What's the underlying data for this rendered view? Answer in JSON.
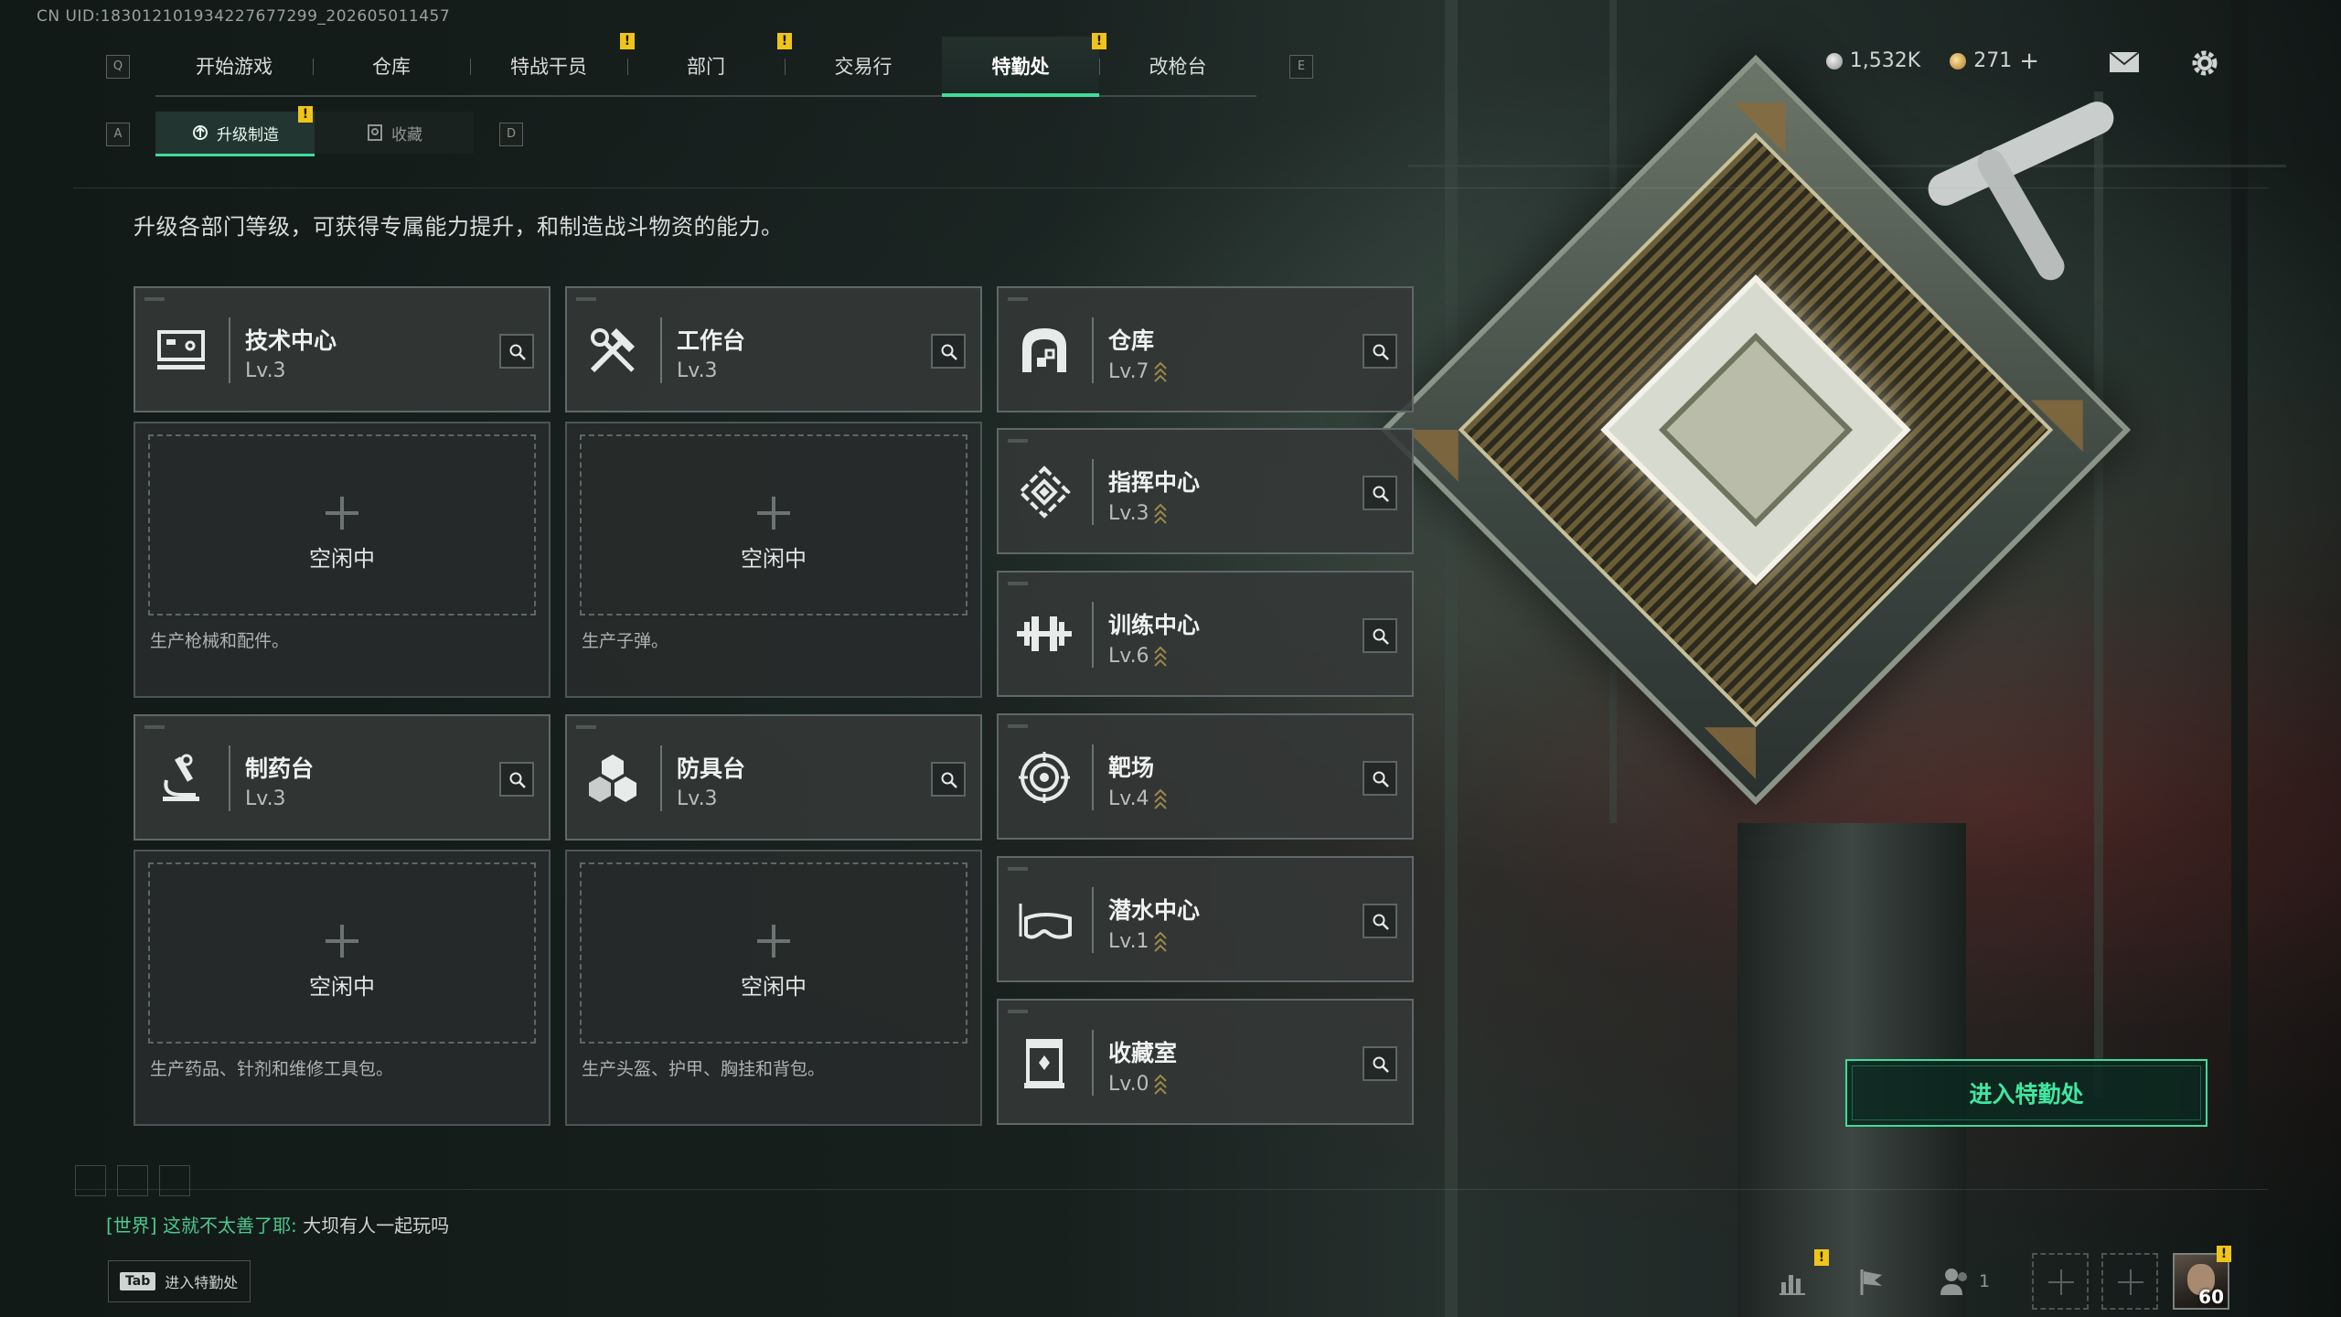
{
  "uid": "CN UID:18301210193422767​7299_202605011457",
  "keyhints": {
    "q": "Q",
    "e": "E",
    "a": "A",
    "d": "D"
  },
  "top_nav": [
    {
      "label": "开始游戏",
      "alert": false
    },
    {
      "label": "仓库",
      "alert": false
    },
    {
      "label": "特战干员",
      "alert": true
    },
    {
      "label": "部门",
      "alert": true
    },
    {
      "label": "交易行",
      "alert": false
    },
    {
      "label": "特勤处",
      "alert": true,
      "active": true
    },
    {
      "label": "改枪台",
      "alert": false
    }
  ],
  "alert_mark": "!",
  "currencies": {
    "silver": "1,532K",
    "gold": "271",
    "gold_add": "+"
  },
  "sub_nav": [
    {
      "label": "升级制造",
      "active": true,
      "alert": true
    },
    {
      "label": "收藏",
      "active": false,
      "alert": false
    }
  ],
  "description": "升级各部门等级，可获得专属能力提升，和制造战斗物资的能力。",
  "production_cards": [
    {
      "title": "技术中心",
      "level": "Lv.3",
      "icon": "tech-center-icon",
      "slot_label": "空闲中",
      "desc": "生产枪械和配件。"
    },
    {
      "title": "工作台",
      "level": "Lv.3",
      "icon": "workbench-icon",
      "slot_label": "空闲中",
      "desc": "生产子弹。"
    },
    {
      "title": "制药台",
      "level": "Lv.3",
      "icon": "pharmacy-icon",
      "slot_label": "空闲中",
      "desc": "生产药品、针剂和维修工具包。"
    },
    {
      "title": "防具台",
      "level": "Lv.3",
      "icon": "armor-bench-icon",
      "slot_label": "空闲中",
      "desc": "生产头盔、护甲、胸挂和背包。"
    }
  ],
  "facility_cards": [
    {
      "title": "仓库",
      "level": "Lv.7",
      "icon": "warehouse-icon"
    },
    {
      "title": "指挥中心",
      "level": "Lv.3",
      "icon": "command-center-icon"
    },
    {
      "title": "训练中心",
      "level": "Lv.6",
      "icon": "training-center-icon"
    },
    {
      "title": "靶场",
      "level": "Lv.4",
      "icon": "shooting-range-icon"
    },
    {
      "title": "潜水中心",
      "level": "Lv.1",
      "icon": "diving-center-icon"
    },
    {
      "title": "收藏室",
      "level": "Lv.0",
      "icon": "collection-room-icon"
    }
  ],
  "enter_button": "进入特勤处",
  "chat": {
    "channel": "[世界]",
    "sender": "这就不太善了耶:",
    "message": "大坝有人一起玩吗"
  },
  "tab_hint": {
    "key": "Tab",
    "label": "进入特勤处"
  },
  "friends_online": "1",
  "player_level": "60",
  "colors": {
    "accent": "#3fdc9a",
    "alert": "#f0c419",
    "level_up": "#9a8a4a"
  }
}
